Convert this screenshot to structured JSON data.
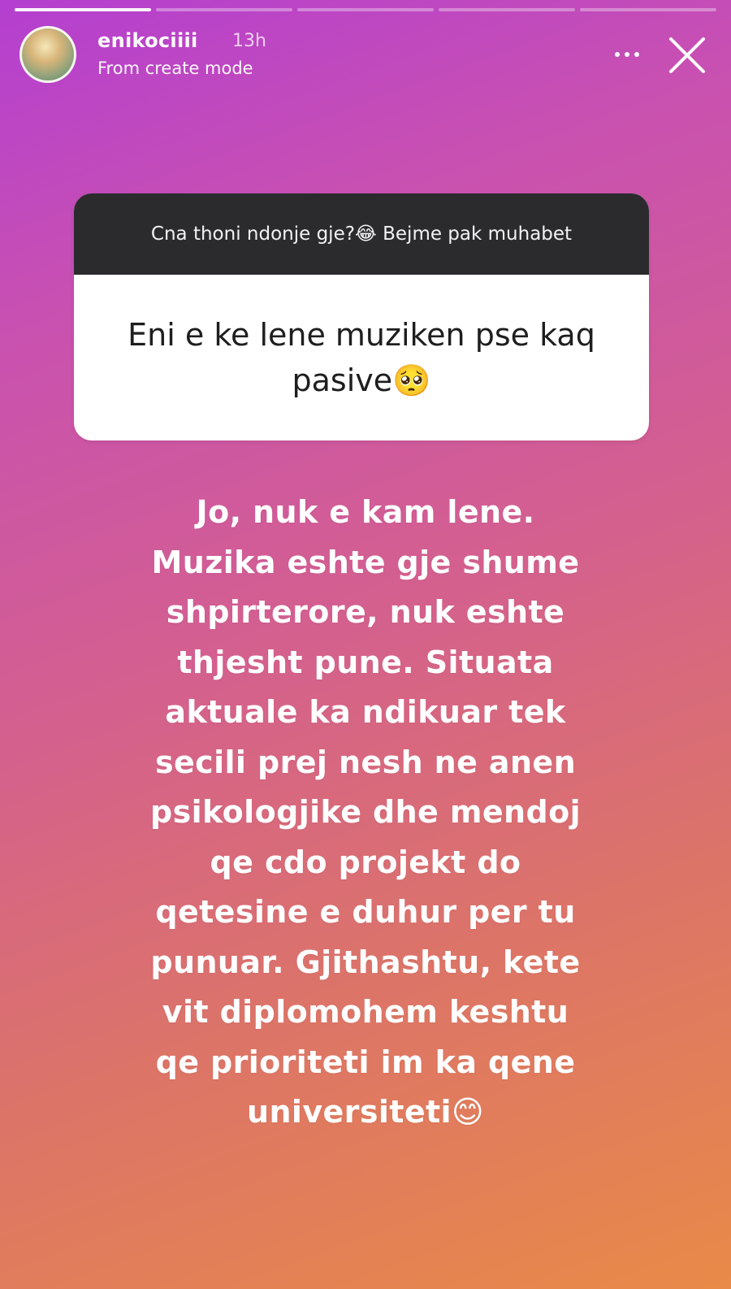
{
  "story": {
    "progress": {
      "total": 5,
      "completed": 1
    },
    "username": "enikociiii",
    "time": "13h",
    "subtitle": "From create mode",
    "question_prompt": "Cna thoni ndonje gje?😂 Bejme pak muhabet",
    "question_text": "Eni e ke lene muziken pse kaq pasive🥺",
    "answer_lines": [
      "Jo, nuk e kam lene.",
      "Muzika eshte gje shume",
      "shpirterore, nuk eshte",
      "thjesht pune. Situata",
      "aktuale ka ndikuar tek",
      "secili prej nesh ne anen",
      "psikologjike dhe mendoj",
      "qe cdo projekt do",
      "qetesine e duhur per tu",
      "punuar. Gjithashtu, kete",
      "vit diplomohem keshtu",
      "qe prioriteti im ka qene",
      "universiteti😊"
    ]
  },
  "colors": {
    "gradient_start": "#b43fd0",
    "gradient_end": "#e98a48",
    "question_header_bg": "#2b2b2e",
    "question_body_bg": "#ffffff"
  },
  "icons": {
    "more": "more-horizontal-icon",
    "close": "close-icon"
  }
}
